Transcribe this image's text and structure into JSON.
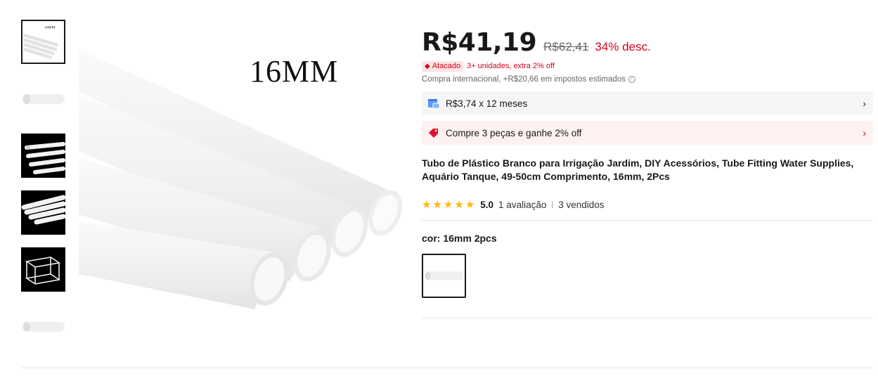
{
  "gallery": {
    "thumbnails": [
      {
        "icon": "pipes-bundle-16mm-thumbnail",
        "label": "16MM"
      },
      {
        "icon": "single-pipe-thumbnail"
      },
      {
        "icon": "pipes-black-background-thumbnail"
      },
      {
        "icon": "pipes-row-black-background-thumbnail"
      },
      {
        "icon": "aquarium-frame-thumbnail"
      },
      {
        "icon": "single-pipe-thumbnail"
      }
    ],
    "main_image_label": "16MM"
  },
  "product": {
    "price": "R$41,19",
    "old_price": "R$62,41",
    "discount": "34% desc.",
    "wholesale_badge": "Atacado",
    "wholesale_text": "3+ unidades, extra 2% off",
    "import_text": "Compra internacional, +R$20,66 em impostos estimados",
    "installments": "R$3,74 x 12 meses",
    "promo": "Compre 3 peças e ganhe 2% off",
    "title": "Tubo de Plástico Branco para Irrigação Jardim, DIY Acessórios, Tube Fitting Water Supplies, Aquário Tanque, 49-50cm Comprimento, 16mm, 2Pcs",
    "rating": "5.0",
    "reviews": "1 avaliação",
    "separator": "|",
    "sold": "3 vendidos",
    "stars": 5,
    "color_label": "cor:",
    "color_value": "16mm 2pcs"
  },
  "colors": {
    "price": "#191919",
    "discount": "#d3031c",
    "star": "#fdb900",
    "installments_bg": "#f5f5f5",
    "promo_bg": "#fff0f1"
  }
}
